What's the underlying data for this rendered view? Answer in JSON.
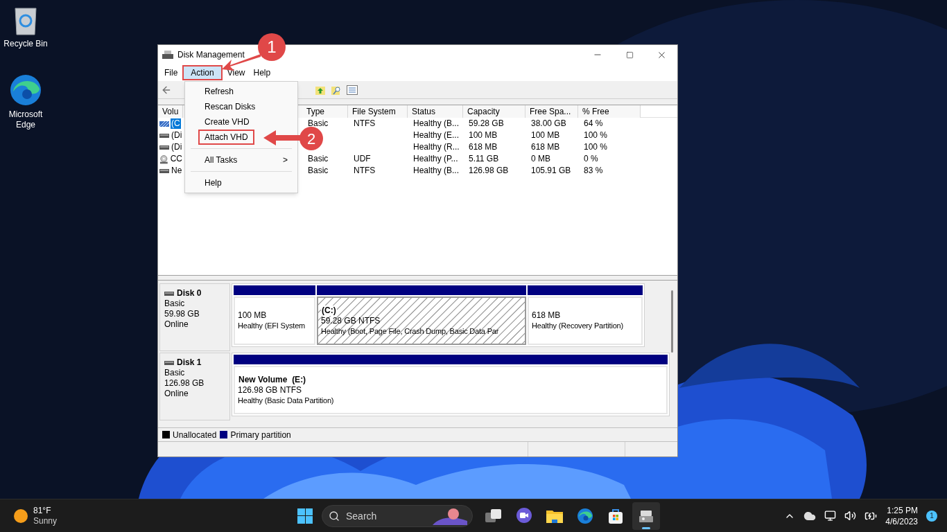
{
  "desktop_icons": [
    {
      "kind": "recycle",
      "label": "Recycle Bin"
    },
    {
      "kind": "edge",
      "label": "Microsoft Edge"
    }
  ],
  "window": {
    "title": "Disk Management",
    "menu": [
      {
        "label": "File",
        "selected": false,
        "marked": false
      },
      {
        "label": "Action",
        "selected": true,
        "marked": true
      },
      {
        "label": "View",
        "selected": false,
        "marked": false
      },
      {
        "label": "Help",
        "selected": false,
        "marked": false
      }
    ],
    "action_menu": [
      {
        "kind": "item",
        "label": "Refresh",
        "marked": false
      },
      {
        "kind": "item",
        "label": "Rescan Disks",
        "marked": false
      },
      {
        "kind": "item",
        "label": "Create VHD",
        "marked": false
      },
      {
        "kind": "item",
        "label": "Attach VHD",
        "marked": true
      },
      {
        "kind": "separator"
      },
      {
        "kind": "submenu",
        "label": "All Tasks",
        "arrow": ">",
        "marked": false
      },
      {
        "kind": "separator"
      },
      {
        "kind": "item",
        "label": "Help",
        "marked": false
      }
    ],
    "table": {
      "columns": [
        "Volu",
        "Type",
        "File System",
        "Status",
        "Capacity",
        "Free Spa...",
        "% Free"
      ],
      "rows": [
        {
          "kind": "volume",
          "volume": "(C",
          "type": "Basic",
          "file_system": "NTFS",
          "status": "Healthy (B...",
          "capacity": "59.28 GB",
          "free_space": "38.00 GB",
          "percent_free": "64 %",
          "selected": true
        },
        {
          "kind": "disk",
          "volume": "(Di",
          "status": "Healthy (E...",
          "capacity": "100 MB",
          "free_space": "100 MB",
          "percent_free": "100 %",
          "selected": false
        },
        {
          "kind": "disk",
          "volume": "(Di",
          "status": "Healthy (R...",
          "capacity": "618 MB",
          "free_space": "618 MB",
          "percent_free": "100 %",
          "selected": false
        },
        {
          "kind": "cdrom",
          "volume": "CC",
          "type": "Basic",
          "file_system": "UDF",
          "status": "Healthy (P...",
          "capacity": "5.11 GB",
          "free_space": "0 MB",
          "percent_free": "0 %",
          "selected": false
        },
        {
          "kind": "disk",
          "volume": "Ne",
          "type": "Basic",
          "file_system": "NTFS",
          "status": "Healthy (B...",
          "capacity": "126.98 GB",
          "free_space": "105.91 GB",
          "percent_free": "83 %",
          "selected": false
        }
      ]
    },
    "disks": [
      {
        "name": "Disk 0",
        "type": "Basic",
        "size": "59.98 GB",
        "status": "Online",
        "partitions": [
          {
            "size": "100 MB",
            "status": "Healthy (EFI System",
            "selected": false
          },
          {
            "name": "(C:)",
            "size": "59.28 GB NTFS",
            "status": "Healthy (Boot, Page File, Crash Dump, Basic Data Par",
            "selected": true
          },
          {
            "size": "618 MB",
            "status": "Healthy (Recovery Partition)",
            "selected": false
          }
        ]
      },
      {
        "name": "Disk 1",
        "type": "Basic",
        "size": "126.98 GB",
        "status": "Online",
        "partitions": [
          {
            "name": "New Volume  (E:)",
            "size": "126.98 GB NTFS",
            "status": "Healthy (Basic Data Partition)",
            "selected": false
          }
        ]
      }
    ],
    "legend": [
      {
        "label": "Unallocated",
        "color": "#000000"
      },
      {
        "label": "Primary partition",
        "color": "#000080"
      }
    ]
  },
  "annotations": [
    {
      "number": "1"
    },
    {
      "number": "2"
    }
  ],
  "taskbar": {
    "weather": {
      "temperature": "81°F",
      "condition": "Sunny"
    },
    "search": {
      "placeholder": "Search"
    },
    "apps": [
      {
        "kind": "taskview",
        "active": false
      },
      {
        "kind": "meet",
        "active": false
      },
      {
        "kind": "explorer",
        "active": false
      },
      {
        "kind": "edge",
        "active": false
      },
      {
        "kind": "store",
        "active": false
      },
      {
        "kind": "diskmgmt",
        "active": true
      }
    ],
    "time": "1:25 PM",
    "date": "4/6/2023",
    "notifications": "1"
  }
}
